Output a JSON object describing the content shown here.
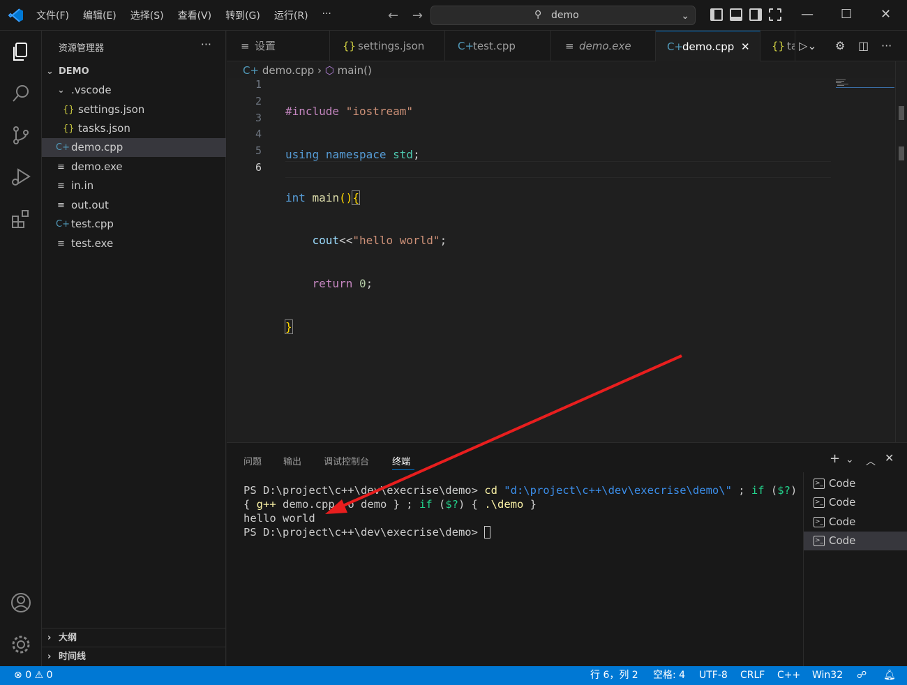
{
  "titlebar": {
    "menu": [
      "文件(F)",
      "编辑(E)",
      "选择(S)",
      "查看(V)",
      "转到(G)",
      "运行(R)",
      "···"
    ],
    "search_text": "demo"
  },
  "sidebar": {
    "title": "资源管理器",
    "more": "···",
    "root": "DEMO",
    "items": [
      {
        "label": ".vscode",
        "icon": "chevron-down"
      },
      {
        "label": "settings.json",
        "icon": "{}"
      },
      {
        "label": "tasks.json",
        "icon": "{}"
      },
      {
        "label": "demo.cpp",
        "icon": "C+"
      },
      {
        "label": "demo.exe",
        "icon": "≡"
      },
      {
        "label": "in.in",
        "icon": "≡"
      },
      {
        "label": "out.out",
        "icon": "≡"
      },
      {
        "label": "test.cpp",
        "icon": "C+"
      },
      {
        "label": "test.exe",
        "icon": "≡"
      }
    ],
    "outline": "大纲",
    "timeline": "时间线"
  },
  "tabs": [
    {
      "label": "设置",
      "icon": "≡"
    },
    {
      "label": "settings.json",
      "icon": "{}"
    },
    {
      "label": "test.cpp",
      "icon": "C+"
    },
    {
      "label": "demo.exe",
      "icon": "≡"
    },
    {
      "label": "demo.cpp",
      "icon": "C+",
      "close": "✕"
    },
    {
      "label": "ta",
      "icon": "{}"
    }
  ],
  "breadcrumb": {
    "file": "demo.cpp",
    "symbol": "main()"
  },
  "editor": {
    "line_numbers": [
      "1",
      "2",
      "3",
      "4",
      "5",
      "6"
    ],
    "current_line": 6
  },
  "panel": {
    "tabs": [
      "问题",
      "输出",
      "调试控制台",
      "终端"
    ],
    "active_tab": "终端",
    "terminal_instances": [
      "Code",
      "Code",
      "Code",
      "Code"
    ]
  },
  "statusbar": {
    "errors": "0",
    "warnings": "0",
    "position": "行 6，列 2",
    "spaces": "空格: 4",
    "encoding": "UTF-8",
    "eol": "CRLF",
    "language": "C++",
    "platform": "Win32"
  },
  "colors": {
    "accent": "#0078d4",
    "arrow": "#e81e1e"
  }
}
